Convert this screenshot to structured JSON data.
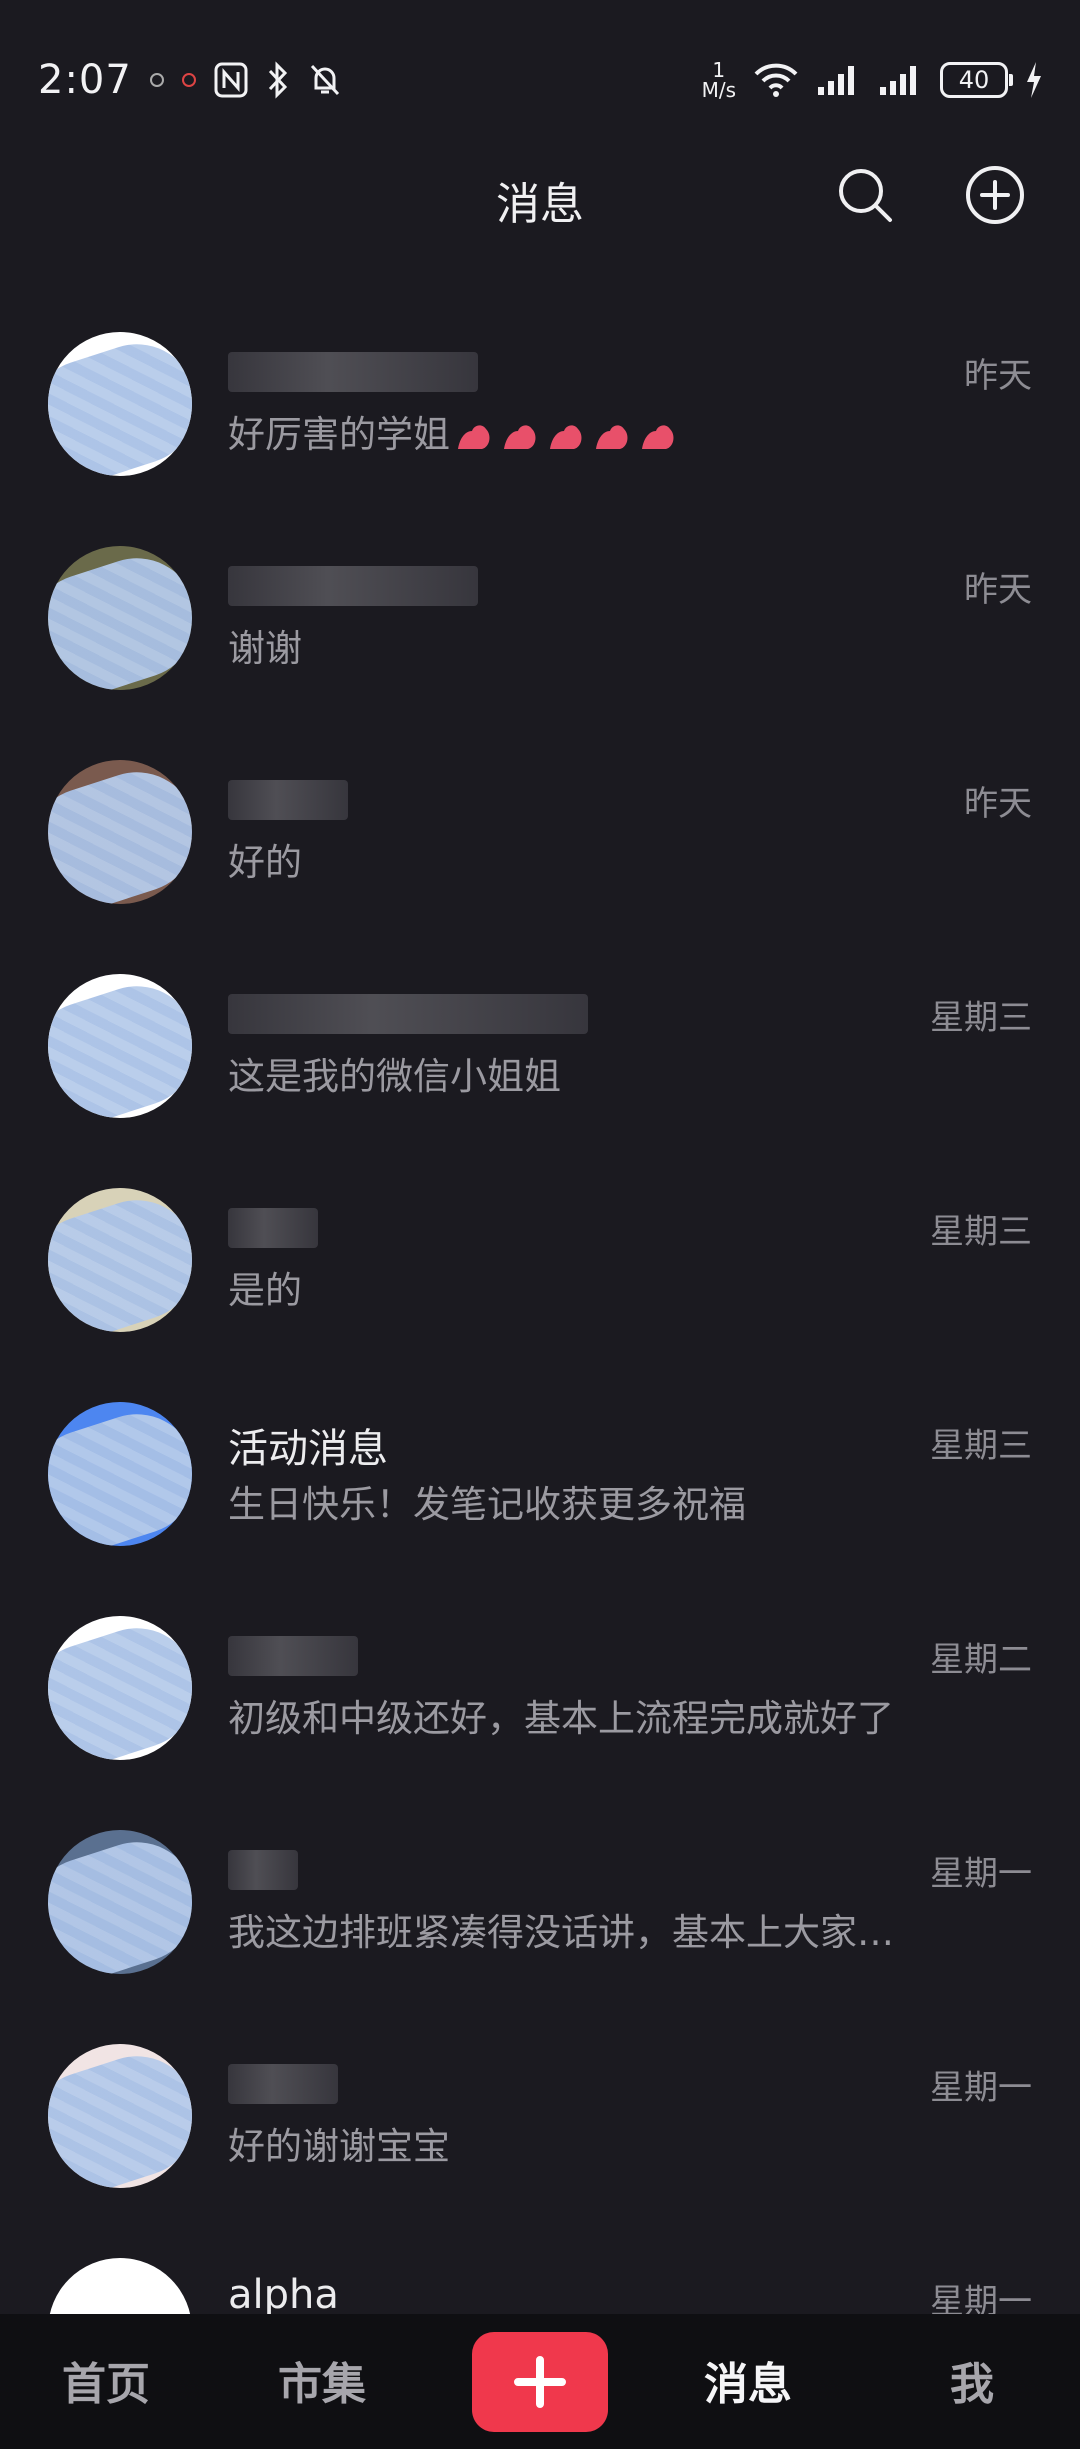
{
  "status_bar": {
    "time": "2:07",
    "net_speed_value": "1",
    "net_speed_unit": "M/s",
    "battery": "40"
  },
  "header": {
    "title": "消息"
  },
  "conversations": [
    {
      "name": "",
      "preview": "好厉害的学姐",
      "time": "昨天",
      "avatar_bg": "#ffffff",
      "name_mask_width": 0,
      "has_flex_emoji": true
    },
    {
      "name": "",
      "preview": "谢谢",
      "time": "昨天",
      "avatar_bg": "#6a6a4a"
    },
    {
      "name": "",
      "preview": "好的",
      "time": "昨天",
      "avatar_bg": "#7a5a4e"
    },
    {
      "name": "",
      "preview": "这是我的微信小姐姐",
      "time": "星期三",
      "avatar_bg": "#ffffff"
    },
    {
      "name": "",
      "preview": "是的",
      "time": "星期三",
      "avatar_bg": "#d8d2b8"
    },
    {
      "name": "活动消息",
      "preview": "生日快乐！发笔记收获更多祝福",
      "time": "星期三",
      "avatar_bg": "#4d86f0"
    },
    {
      "name": "",
      "preview": "初级和中级还好，基本上流程完成就好了",
      "time": "星期二",
      "avatar_bg": "#ffffff"
    },
    {
      "name": "",
      "preview": "我这边排班紧凑得没话讲，基本上大家…",
      "time": "星期一",
      "avatar_bg": "#5a7090"
    },
    {
      "name": "",
      "preview": "好的谢谢宝宝",
      "time": "星期一",
      "avatar_bg": "#f1e4e4"
    },
    {
      "name": "alpha",
      "preview": "",
      "time": "星期一",
      "avatar_bg": "#ffffff"
    }
  ],
  "bottom_nav": {
    "home": "首页",
    "market": "市集",
    "messages": "消息",
    "me": "我"
  },
  "colors": {
    "background": "#1b1a20",
    "accent": "#f0384c",
    "nav_bg": "#0f0f12"
  },
  "icons": {
    "search": "search-icon",
    "add": "add-circle-icon",
    "plus": "plus-icon"
  }
}
